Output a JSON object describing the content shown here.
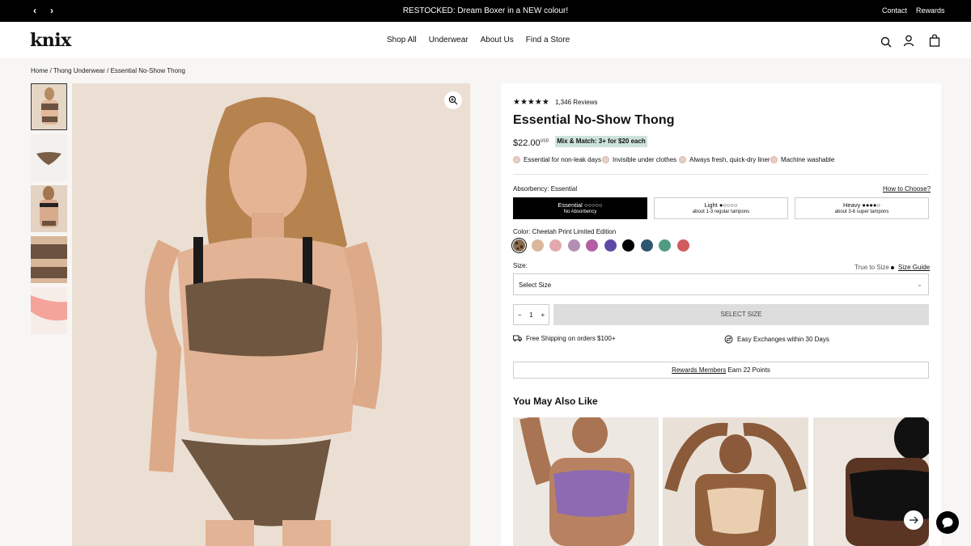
{
  "announcement": {
    "prev": "‹",
    "next": "›",
    "message": "RESTOCKED: Dream Boxer in a NEW colour!",
    "contact": "Contact",
    "rewards": "Rewards"
  },
  "header": {
    "logo": "knix",
    "nav": [
      "Shop All",
      "Underwear",
      "About Us",
      "Find a Store"
    ]
  },
  "breadcrumb": "Home / Thong Underwear / Essential No-Show Thong",
  "product": {
    "stars": "★★★★★",
    "rating": 4.5,
    "reviews": "1,346 Reviews",
    "title": "Essential No-Show Thong",
    "price": "$22.00",
    "currency": "USD",
    "promo": "Mix & Match: 3+ for $20 each",
    "features": [
      "Essential for non-leak days",
      "Invisible under clothes",
      "Always fresh, quick-dry liner",
      "Machine washable"
    ],
    "absorbency_label": "Absorbency: Essential",
    "how_to_choose": "How to Choose?",
    "absorbency_options": [
      {
        "name": "Essential",
        "drops": "○○○○○",
        "desc": "No Absorbency"
      },
      {
        "name": "Light",
        "drops": "●○○○○",
        "desc": "about 1-3 regular tampons"
      },
      {
        "name": "Heavy",
        "drops": "●●●●○",
        "desc": "about 3-6 super tampons"
      }
    ],
    "color_label": "Color: Cheetah Print Limited Edition",
    "swatch_colors": [
      "#8a6a4e",
      "#d9b79c",
      "#e3a8ab",
      "#b58fb3",
      "#b55fa3",
      "#5d4aa6",
      "#000000",
      "#2f5670",
      "#4f9b83",
      "#d25a5c"
    ],
    "size_label": "Size:",
    "true_to_size": "True to Size",
    "size_guide": "Size Guide",
    "size_placeholder": "Select Size",
    "qty_minus": "−",
    "qty": "1",
    "qty_plus": "+",
    "select_size_btn": "SELECT SIZE",
    "free_shipping": "Free Shipping on orders $100+",
    "exchanges": "Easy Exchanges within 30 Days",
    "rewards_link": "Rewards Members",
    "rewards_text": " Earn 22 Points",
    "ymal_title": "You May Also Like"
  },
  "colors": {
    "accent_green": "#cde3da",
    "cta_disabled": "#dddddd"
  }
}
